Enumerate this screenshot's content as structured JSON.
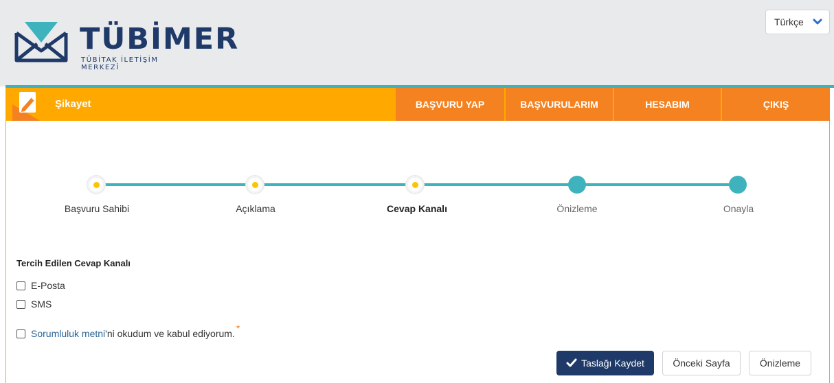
{
  "header": {
    "logo_title": "TÜBİMER",
    "logo_subtitle": "TÜBİTAK İLETİŞİM MERKEZİ",
    "language": "Türkçe"
  },
  "navbar": {
    "page_title": "Şikayet",
    "items": [
      {
        "label": "BAŞVURU YAP"
      },
      {
        "label": "BAŞVURULARIM"
      },
      {
        "label": "HESABIM"
      },
      {
        "label": "ÇIKIŞ"
      }
    ]
  },
  "stepper": {
    "steps": [
      {
        "label": "Başvuru Sahibi",
        "state": "done"
      },
      {
        "label": "Açıklama",
        "state": "done"
      },
      {
        "label": "Cevap Kanalı",
        "state": "active"
      },
      {
        "label": "Önizleme",
        "state": "todo"
      },
      {
        "label": "Onayla",
        "state": "todo"
      }
    ]
  },
  "form": {
    "section_title": "Tercih Edilen Cevap Kanalı",
    "options": [
      {
        "label": "E-Posta",
        "checked": false
      },
      {
        "label": "SMS",
        "checked": false
      }
    ],
    "agreement": {
      "link_text": "Sorumluluk metni",
      "rest_text": "'ni okudum ve kabul ediyorum.",
      "required_mark": "*",
      "checked": false
    }
  },
  "actions": {
    "save_draft": "Taslağı Kaydet",
    "previous_page": "Önceki Sayfa",
    "preview": "Önizleme"
  },
  "colors": {
    "brand_navy": "#1f3a68",
    "nav_orange": "#ffa800",
    "nav_item_orange": "#f58220",
    "teal": "#3fb3bd",
    "step_done_dot": "#ffc400"
  }
}
